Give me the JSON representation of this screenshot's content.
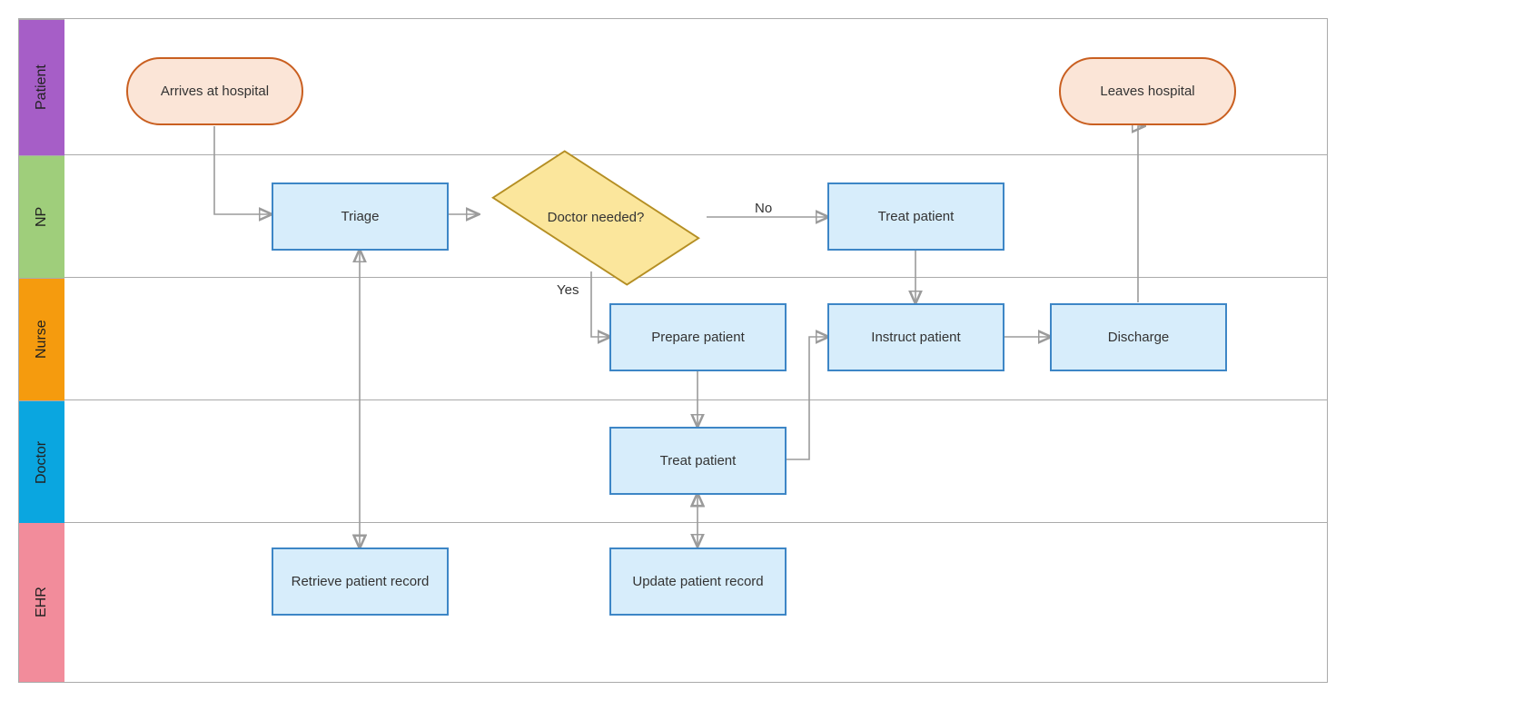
{
  "chart_data": {
    "type": "swimlane-flowchart",
    "lanes": [
      {
        "id": "patient",
        "label": "Patient"
      },
      {
        "id": "np",
        "label": "NP"
      },
      {
        "id": "nurse",
        "label": "Nurse"
      },
      {
        "id": "doctor",
        "label": "Doctor"
      },
      {
        "id": "ehr",
        "label": "EHR"
      }
    ],
    "nodes": [
      {
        "id": "arrives",
        "lane": "patient",
        "type": "terminator",
        "label": "Arrives at hospital"
      },
      {
        "id": "leaves",
        "lane": "patient",
        "type": "terminator",
        "label": "Leaves hospital"
      },
      {
        "id": "triage",
        "lane": "np",
        "type": "process",
        "label": "Triage"
      },
      {
        "id": "docneeded",
        "lane": "np",
        "type": "decision",
        "label": "Doctor needed?"
      },
      {
        "id": "np_treat",
        "lane": "np",
        "type": "process",
        "label": "Treat patient"
      },
      {
        "id": "prepare",
        "lane": "nurse",
        "type": "process",
        "label": "Prepare patient"
      },
      {
        "id": "instruct",
        "lane": "nurse",
        "type": "process",
        "label": "Instruct patient"
      },
      {
        "id": "discharge",
        "lane": "nurse",
        "type": "process",
        "label": "Discharge"
      },
      {
        "id": "dr_treat",
        "lane": "doctor",
        "type": "process",
        "label": "Treat patient"
      },
      {
        "id": "retrieve",
        "lane": "ehr",
        "type": "process",
        "label": "Retrieve patient record"
      },
      {
        "id": "update",
        "lane": "ehr",
        "type": "process",
        "label": "Update patient record"
      }
    ],
    "edges": [
      {
        "from": "arrives",
        "to": "triage"
      },
      {
        "from": "triage",
        "to": "docneeded"
      },
      {
        "from": "docneeded",
        "to": "np_treat",
        "label": "No"
      },
      {
        "from": "docneeded",
        "to": "prepare",
        "label": "Yes"
      },
      {
        "from": "np_treat",
        "to": "instruct"
      },
      {
        "from": "prepare",
        "to": "dr_treat"
      },
      {
        "from": "dr_treat",
        "to": "instruct"
      },
      {
        "from": "dr_treat",
        "to": "update",
        "bidirectional": true
      },
      {
        "from": "instruct",
        "to": "discharge"
      },
      {
        "from": "discharge",
        "to": "leaves"
      },
      {
        "from": "retrieve",
        "to": "triage",
        "bidirectional": true
      }
    ],
    "edge_labels": {
      "no": "No",
      "yes": "Yes"
    }
  }
}
